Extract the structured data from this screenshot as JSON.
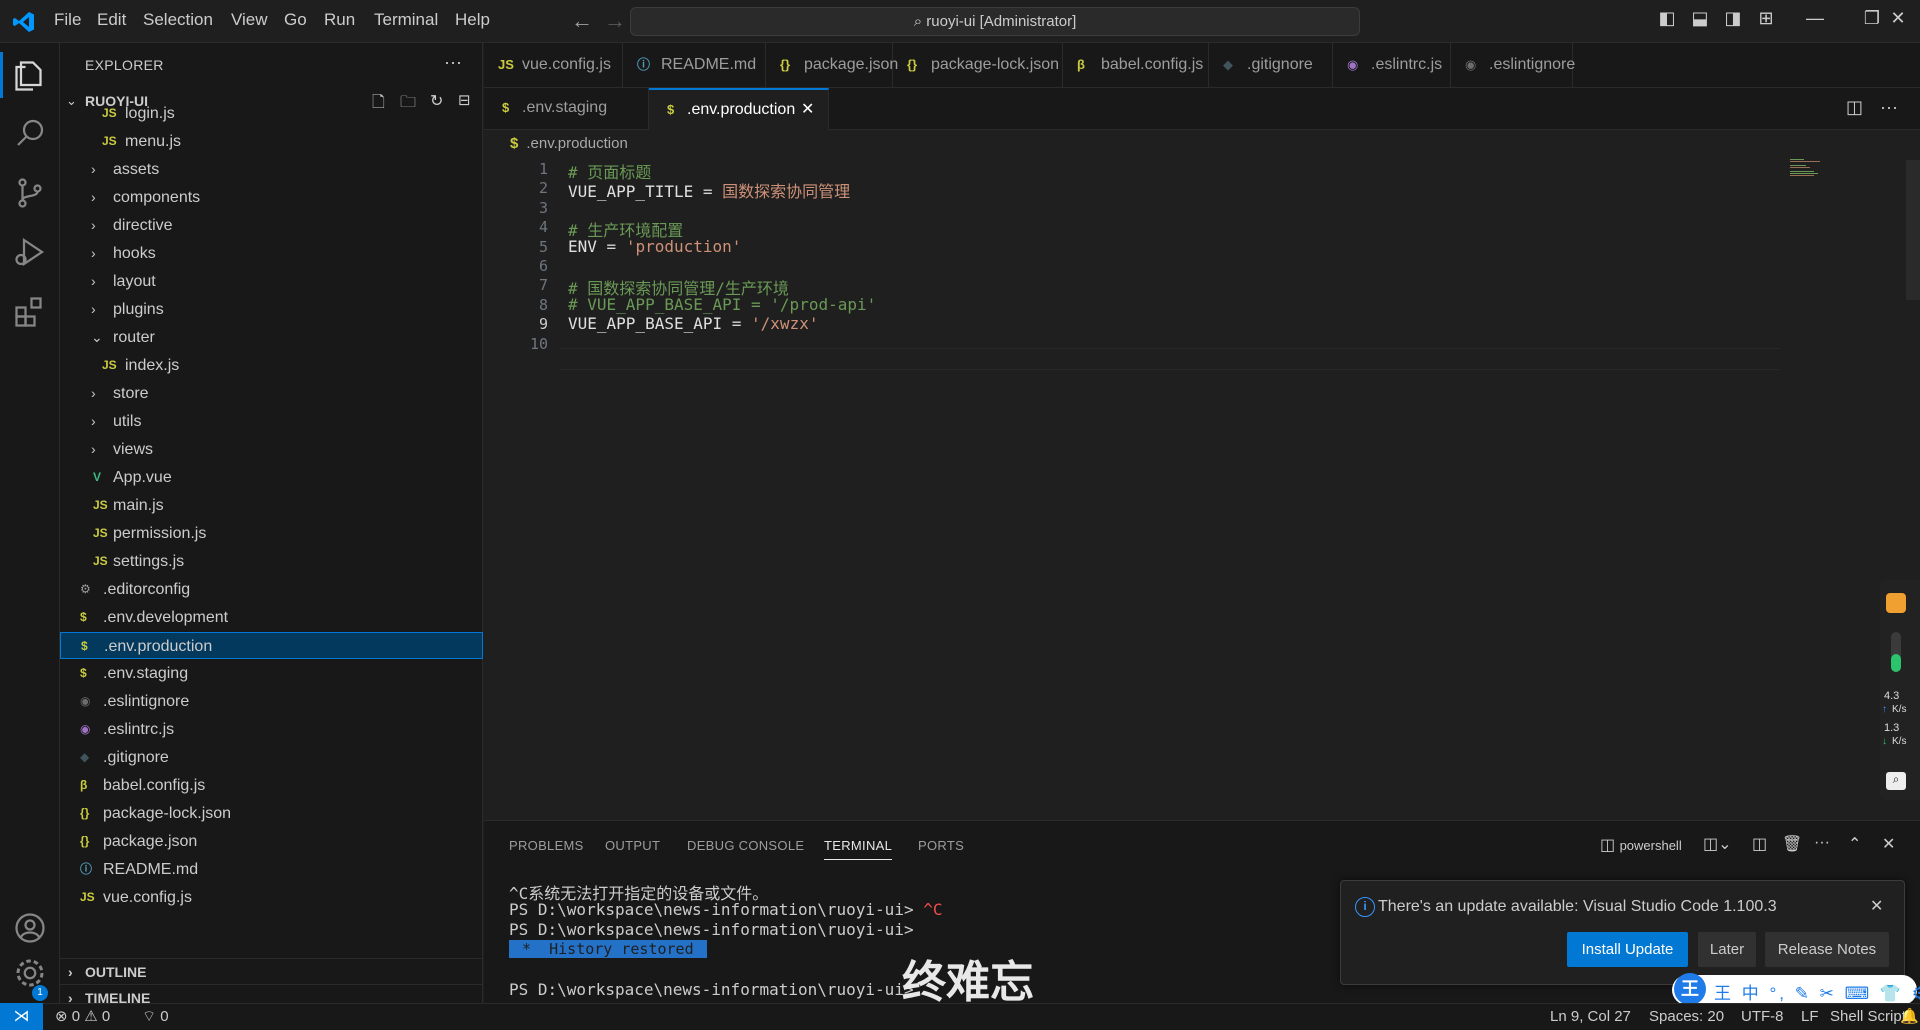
{
  "titlebar": {
    "menus": [
      "File",
      "Edit",
      "Selection",
      "View",
      "Go",
      "Run",
      "Terminal",
      "Help"
    ],
    "search_text": "ruoyi-ui [Administrator]"
  },
  "explorer": {
    "title": "EXPLORER",
    "more": "···",
    "project": "RUOYI-UI",
    "items": [
      {
        "label": "login.js",
        "icon": "JS",
        "indent": 3
      },
      {
        "label": "menu.js",
        "icon": "JS",
        "indent": 3
      },
      {
        "label": "assets",
        "icon": "folder",
        "indent": 2
      },
      {
        "label": "components",
        "icon": "folder",
        "indent": 2
      },
      {
        "label": "directive",
        "icon": "folder",
        "indent": 2
      },
      {
        "label": "hooks",
        "icon": "folder",
        "indent": 2
      },
      {
        "label": "layout",
        "icon": "folder",
        "indent": 2
      },
      {
        "label": "plugins",
        "icon": "folder",
        "indent": 2
      },
      {
        "label": "router",
        "icon": "folder-open",
        "indent": 2
      },
      {
        "label": "index.js",
        "icon": "JS",
        "indent": 3
      },
      {
        "label": "store",
        "icon": "folder",
        "indent": 2
      },
      {
        "label": "utils",
        "icon": "folder",
        "indent": 2
      },
      {
        "label": "views",
        "icon": "folder",
        "indent": 2
      },
      {
        "label": "App.vue",
        "icon": "V",
        "indent": 2
      },
      {
        "label": "main.js",
        "icon": "JS",
        "indent": 2
      },
      {
        "label": "permission.js",
        "icon": "JS",
        "indent": 2
      },
      {
        "label": "settings.js",
        "icon": "JS",
        "indent": 2
      },
      {
        "label": ".editorconfig",
        "icon": "gear",
        "indent": 1
      },
      {
        "label": ".env.development",
        "icon": "$",
        "indent": 1
      },
      {
        "label": ".env.production",
        "icon": "$",
        "indent": 1,
        "selected": true
      },
      {
        "label": ".env.staging",
        "icon": "$",
        "indent": 1
      },
      {
        "label": ".eslintignore",
        "icon": "eslint-gray",
        "indent": 1
      },
      {
        "label": ".eslintrc.js",
        "icon": "eslint",
        "indent": 1
      },
      {
        "label": ".gitignore",
        "icon": "git",
        "indent": 1
      },
      {
        "label": "babel.config.js",
        "icon": "babel",
        "indent": 1
      },
      {
        "label": "package-lock.json",
        "icon": "{}",
        "indent": 1
      },
      {
        "label": "package.json",
        "icon": "{}",
        "indent": 1
      },
      {
        "label": "README.md",
        "icon": "info",
        "indent": 1
      },
      {
        "label": "vue.config.js",
        "icon": "JS",
        "indent": 1
      }
    ],
    "outline": "OUTLINE",
    "timeline": "TIMELINE"
  },
  "tabs_row1": [
    {
      "label": "vue.config.js",
      "icon": "JS",
      "color": "#cbcb41"
    },
    {
      "label": "README.md",
      "icon": "ⓘ",
      "color": "#519aba"
    },
    {
      "label": "package.json",
      "icon": "{}",
      "color": "#cbcb41"
    },
    {
      "label": "package-lock.json",
      "icon": "{}",
      "color": "#cbcb41"
    },
    {
      "label": "babel.config.js",
      "icon": "β",
      "color": "#cbcb41"
    },
    {
      "label": ".gitignore",
      "icon": "◆",
      "color": "#41535b"
    },
    {
      "label": ".eslintrc.js",
      "icon": "◉",
      "color": "#a074c4"
    },
    {
      "label": ".eslintignore",
      "icon": "◉",
      "color": "#6d6d6d"
    }
  ],
  "tabs_row2": [
    {
      "label": ".env.staging",
      "icon": "$",
      "color": "#cbcb41"
    },
    {
      "label": ".env.production",
      "icon": "$",
      "color": "#cbcb41",
      "active": true,
      "close": "✕"
    }
  ],
  "editor": {
    "breadcrumb": ".env.production",
    "breadcrumb_icon": "$",
    "lines": [
      {
        "n": "1",
        "parts": [
          [
            "c-comment",
            "# 页面标题"
          ]
        ]
      },
      {
        "n": "2",
        "parts": [
          [
            "c-key",
            "VUE_APP_TITLE"
          ],
          [
            "c-op",
            " = "
          ],
          [
            "c-val",
            "国数探索协同管理"
          ]
        ]
      },
      {
        "n": "3",
        "parts": []
      },
      {
        "n": "4",
        "parts": [
          [
            "c-comment",
            "# 生产环境配置"
          ]
        ]
      },
      {
        "n": "5",
        "parts": [
          [
            "c-key",
            "ENV"
          ],
          [
            "c-op",
            " = "
          ],
          [
            "c-val",
            "'production'"
          ]
        ]
      },
      {
        "n": "6",
        "parts": []
      },
      {
        "n": "7",
        "parts": [
          [
            "c-comment",
            "# 国数探索协同管理/生产环境"
          ]
        ]
      },
      {
        "n": "8",
        "parts": [
          [
            "c-comment",
            "# VUE_APP_BASE_API = '/prod-api'"
          ]
        ]
      },
      {
        "n": "9",
        "parts": [
          [
            "c-key",
            "VUE_APP_BASE_API"
          ],
          [
            "c-op",
            " = "
          ],
          [
            "c-val",
            "'/xwzx'"
          ]
        ],
        "current": true
      },
      {
        "n": "10",
        "parts": []
      }
    ]
  },
  "panel": {
    "tabs": [
      "PROBLEMS",
      "OUTPUT",
      "DEBUG CONSOLE",
      "TERMINAL",
      "PORTS"
    ],
    "active_tab": "TERMINAL",
    "shell": "powershell",
    "terminal": {
      "line1": "^C系统无法打开指定的设备或文件。",
      "line2_prompt": "PS D:\\workspace\\news-information\\ruoyi-ui> ",
      "line2_red": "^C",
      "line3": "PS D:\\workspace\\news-information\\ruoyi-ui>",
      "history": " *  History restored ",
      "line5": "PS D:\\workspace\\news-information\\ruoyi-ui>"
    }
  },
  "notification": {
    "message": "There's an update available: Visual Studio Code 1.100.3",
    "install": "Install Update",
    "later": "Later",
    "release_notes": "Release Notes"
  },
  "statusbar": {
    "errors": "0",
    "warnings": "0",
    "ports": "0",
    "position": "Ln 9, Col 27",
    "spaces": "Spaces: 20",
    "encoding": "UTF-8",
    "eol": "LF",
    "language": "Shell Script"
  },
  "overlay": {
    "text": "终难忘",
    "net_up": "4.3",
    "net_down": "1.3",
    "net_unit": "K/s",
    "ime_chars": "王 中 °, ✎ ✂ ⌨ 👕 ⚙"
  },
  "colors": {
    "accent": "#0078d4",
    "selection": "#04395e"
  }
}
